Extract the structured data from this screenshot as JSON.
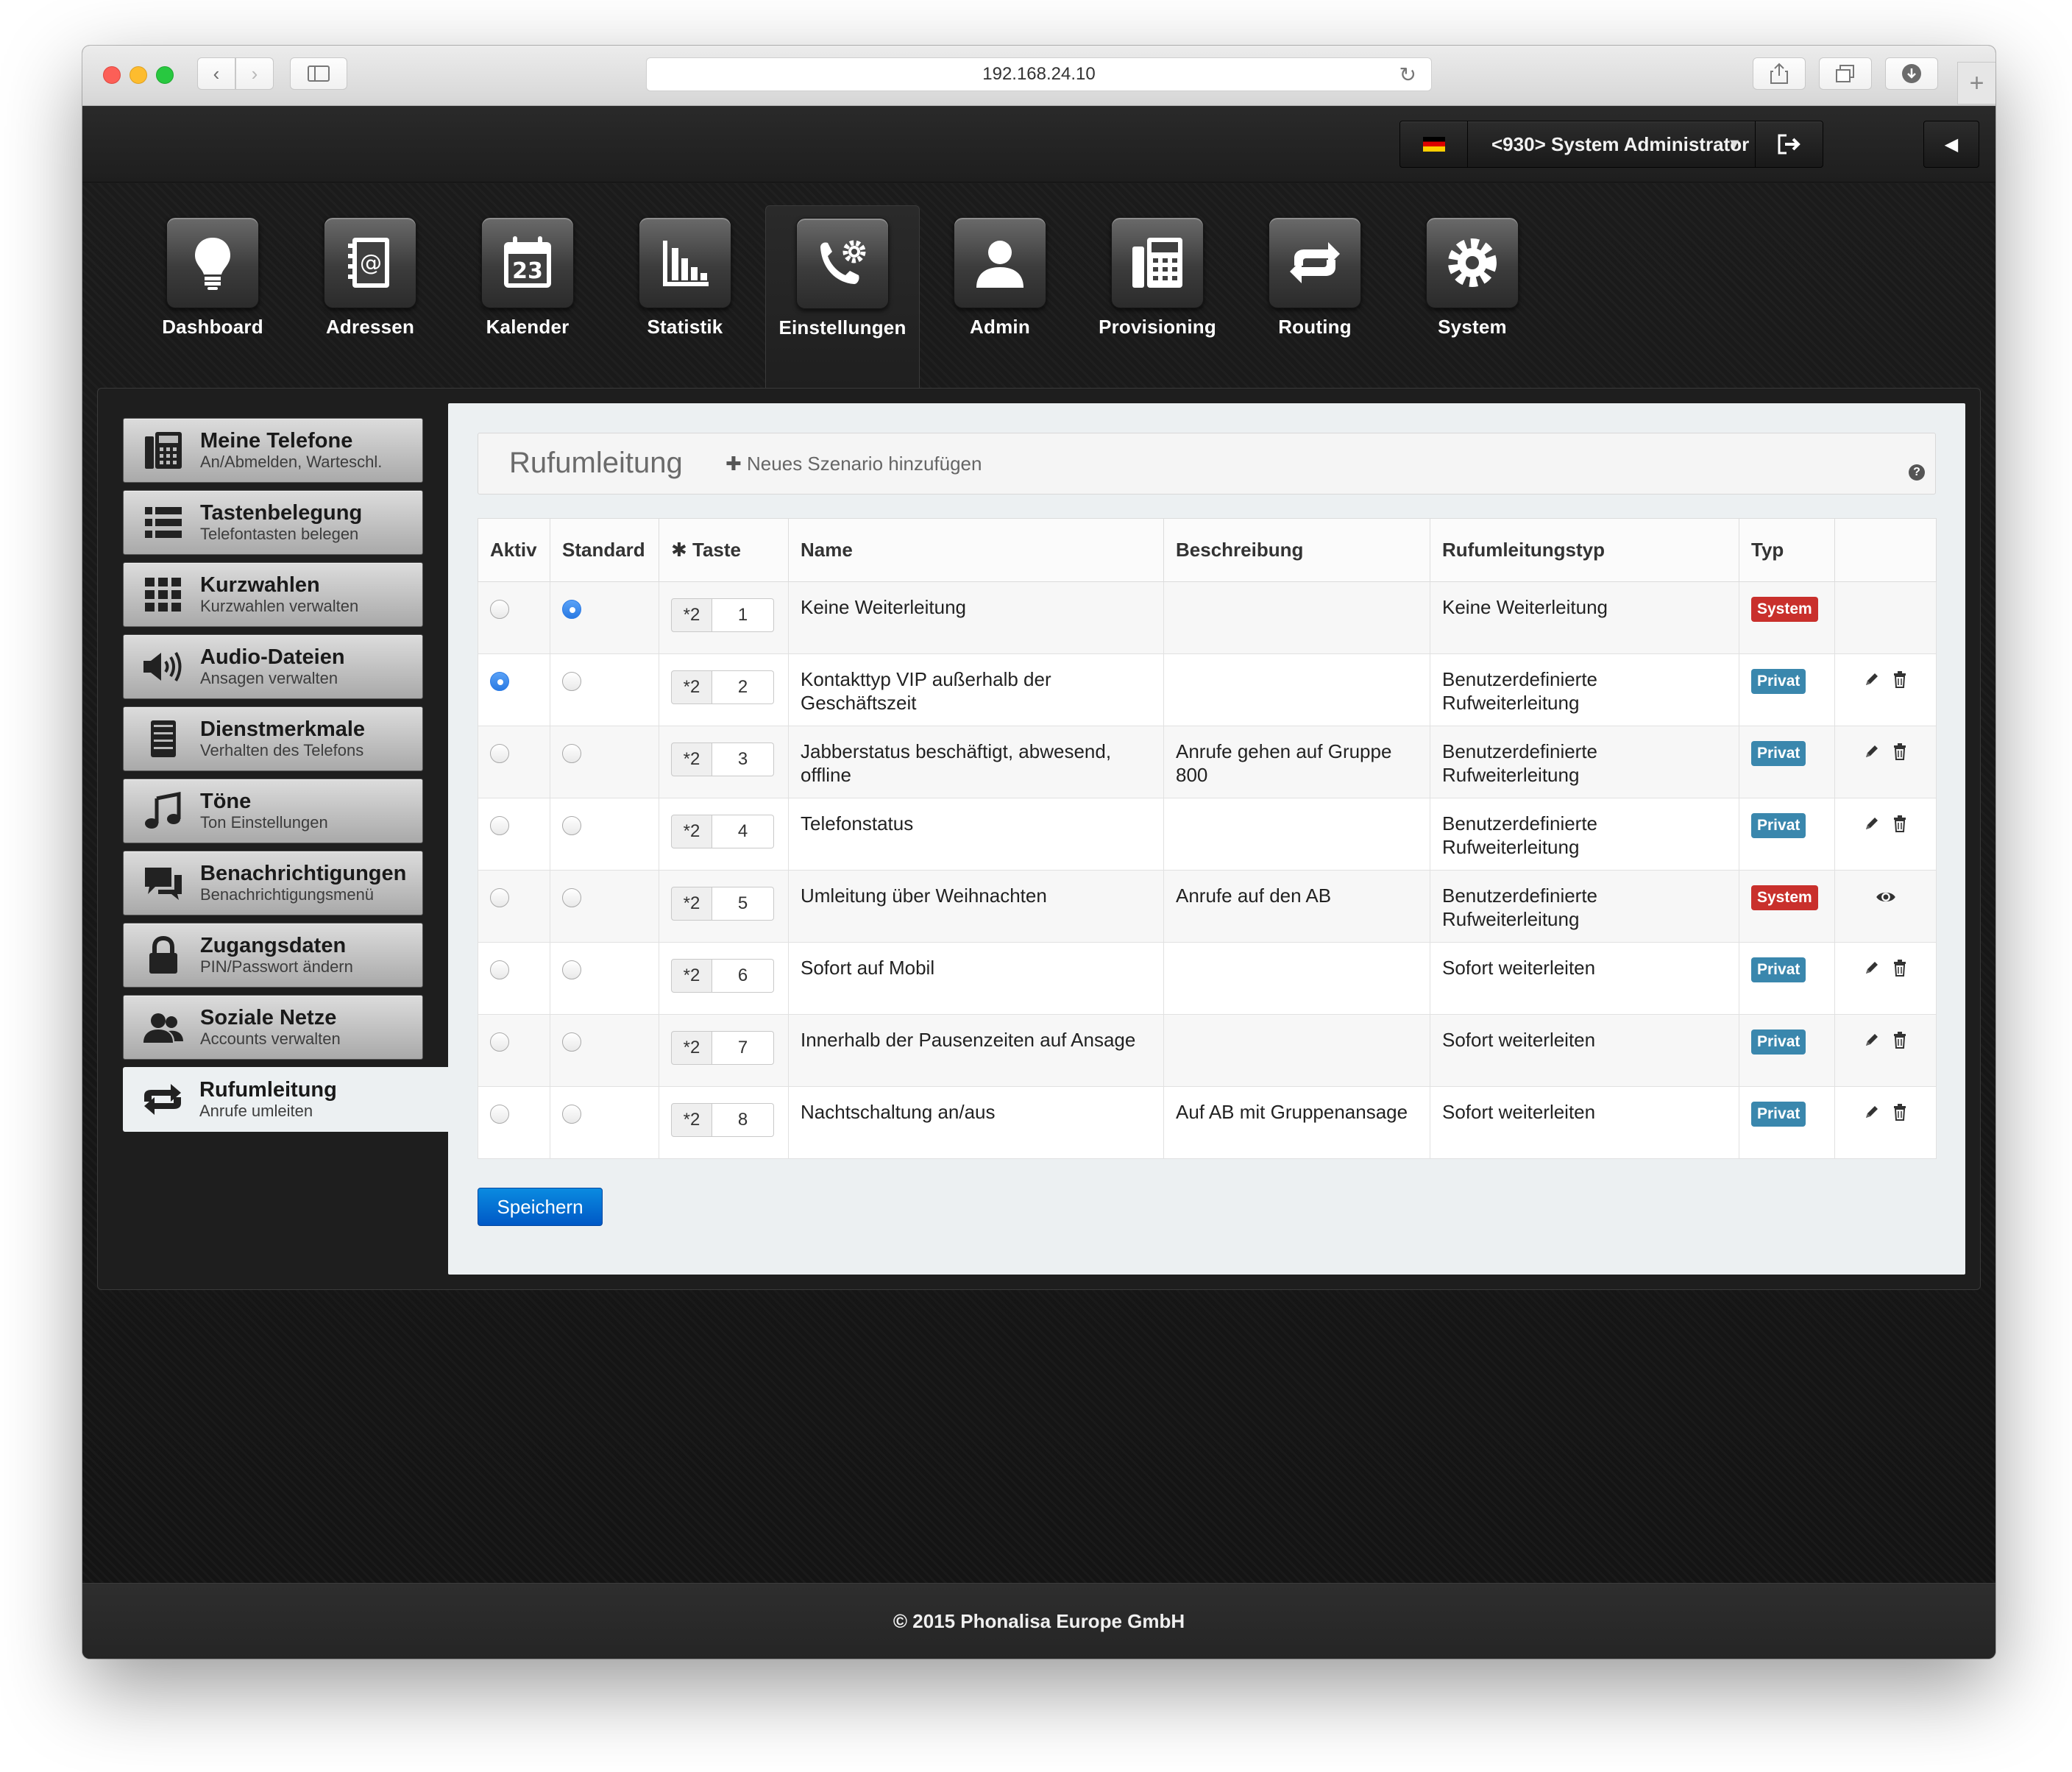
{
  "browser": {
    "url": "192.168.24.10"
  },
  "header": {
    "user_label": "<930> System Administrator",
    "language_flag": "de-flag-icon"
  },
  "nav": {
    "items": [
      {
        "label": "Dashboard",
        "icon": "lightbulb-icon"
      },
      {
        "label": "Adressen",
        "icon": "address-book-icon"
      },
      {
        "label": "Kalender",
        "icon": "calendar-icon",
        "day": "23"
      },
      {
        "label": "Statistik",
        "icon": "bar-chart-icon"
      },
      {
        "label": "Einstellungen",
        "icon": "phone-gear-icon",
        "active": true
      },
      {
        "label": "Admin",
        "icon": "user-icon"
      },
      {
        "label": "Provisioning",
        "icon": "desk-phone-icon"
      },
      {
        "label": "Routing",
        "icon": "routing-arrows-icon"
      },
      {
        "label": "System",
        "icon": "gear-icon"
      }
    ]
  },
  "sidebar": {
    "items": [
      {
        "title": "Meine Telefone",
        "subtitle": "An/Abmelden, Warteschl.",
        "icon": "phone-icon"
      },
      {
        "title": "Tastenbelegung",
        "subtitle": "Telefontasten belegen",
        "icon": "list-icon"
      },
      {
        "title": "Kurzwahlen",
        "subtitle": "Kurzwahlen verwalten",
        "icon": "grid-icon"
      },
      {
        "title": "Audio-Dateien",
        "subtitle": "Ansagen verwalten",
        "icon": "speaker-icon"
      },
      {
        "title": "Dienstmerkmale",
        "subtitle": "Verhalten des Telefons",
        "icon": "cabinet-icon"
      },
      {
        "title": "Töne",
        "subtitle": "Ton Einstellungen",
        "icon": "music-note-icon"
      },
      {
        "title": "Benachrichtigungen",
        "subtitle": "Benachrichtigungsmenü",
        "icon": "chat-icon"
      },
      {
        "title": "Zugangsdaten",
        "subtitle": "PIN/Passwort ändern",
        "icon": "lock-icon"
      },
      {
        "title": "Soziale Netze",
        "subtitle": "Accounts verwalten",
        "icon": "people-icon"
      },
      {
        "title": "Rufumleitung",
        "subtitle": "Anrufe umleiten",
        "icon": "redirect-icon",
        "active": true
      }
    ]
  },
  "content": {
    "title": "Rufumleitung",
    "add_label": "Neues Szenario hinzufügen",
    "save_label": "Speichern",
    "columns": [
      "Aktiv",
      "Standard",
      "Taste",
      "Name",
      "Beschreibung",
      "Rufumleitungstyp",
      "Typ",
      ""
    ],
    "rows": [
      {
        "aktiv": false,
        "standard": true,
        "prefix": "*2",
        "key": "1",
        "name": "Keine Weiterleitung",
        "desc": "",
        "type": "Keine Weiterleitung",
        "badge": "System",
        "actions": "none"
      },
      {
        "aktiv": true,
        "standard": false,
        "prefix": "*2",
        "key": "2",
        "name": "Kontakttyp VIP außerhalb der Geschäftszeit",
        "desc": "",
        "type": "Benutzerdefinierte Rufweiterleitung",
        "badge": "Privat",
        "actions": "edit"
      },
      {
        "aktiv": false,
        "standard": false,
        "prefix": "*2",
        "key": "3",
        "name": "Jabberstatus beschäftigt, abwesend, offline",
        "desc": "Anrufe gehen auf Gruppe 800",
        "type": "Benutzerdefinierte Rufweiterleitung",
        "badge": "Privat",
        "actions": "edit"
      },
      {
        "aktiv": false,
        "standard": false,
        "prefix": "*2",
        "key": "4",
        "name": "Telefonstatus",
        "desc": "",
        "type": "Benutzerdefinierte Rufweiterleitung",
        "badge": "Privat",
        "actions": "edit"
      },
      {
        "aktiv": false,
        "standard": false,
        "prefix": "*2",
        "key": "5",
        "name": "Umleitung über Weihnachten",
        "desc": "Anrufe auf den AB",
        "type": "Benutzerdefinierte Rufweiterleitung",
        "badge": "System",
        "actions": "view"
      },
      {
        "aktiv": false,
        "standard": false,
        "prefix": "*2",
        "key": "6",
        "name": "Sofort auf Mobil",
        "desc": "",
        "type": "Sofort weiterleiten",
        "badge": "Privat",
        "actions": "edit"
      },
      {
        "aktiv": false,
        "standard": false,
        "prefix": "*2",
        "key": "7",
        "name": "Innerhalb der Pausenzeiten auf Ansage",
        "desc": "",
        "type": "Sofort weiterleiten",
        "badge": "Privat",
        "actions": "edit"
      },
      {
        "aktiv": false,
        "standard": false,
        "prefix": "*2",
        "key": "8",
        "name": "Nachtschaltung an/aus",
        "desc": "Auf AB mit Gruppenansage",
        "type": "Sofort weiterleiten",
        "badge": "Privat",
        "actions": "edit"
      }
    ]
  },
  "footer": {
    "copyright": "© 2015 Phonalisa Europe GmbH"
  },
  "colors": {
    "badge_system": "#c9302c",
    "badge_private": "#3a87ad",
    "primary_button": "#0a6fd6",
    "radio_checked": "#2a7ae3"
  }
}
